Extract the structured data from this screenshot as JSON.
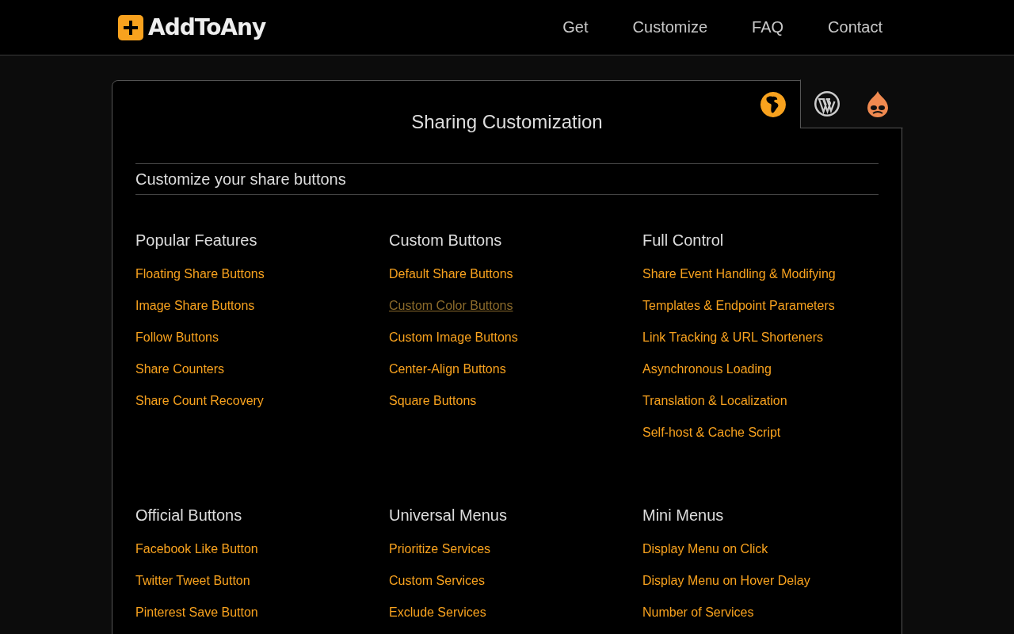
{
  "header": {
    "logo": "AddToAny",
    "nav": [
      {
        "label": "Get"
      },
      {
        "label": "Customize"
      },
      {
        "label": "FAQ"
      },
      {
        "label": "Contact"
      }
    ]
  },
  "platform_tabs": [
    {
      "kind": "globe",
      "selected": true
    },
    {
      "kind": "wordpress",
      "selected": false
    },
    {
      "kind": "drupal",
      "selected": false
    }
  ],
  "title": "Sharing Customization",
  "subtitle": "Customize your share buttons",
  "sections": [
    {
      "heading": "Popular Features",
      "links": [
        {
          "label": "Floating Share Buttons",
          "visited": false
        },
        {
          "label": "Image Share Buttons",
          "visited": false
        },
        {
          "label": "Follow Buttons",
          "visited": false
        },
        {
          "label": "Share Counters",
          "visited": false
        },
        {
          "label": "Share Count Recovery",
          "visited": false
        }
      ]
    },
    {
      "heading": "Custom Buttons",
      "links": [
        {
          "label": "Default Share Buttons",
          "visited": false
        },
        {
          "label": "Custom Color Buttons",
          "visited": true
        },
        {
          "label": "Custom Image Buttons",
          "visited": false
        },
        {
          "label": "Center-Align Buttons",
          "visited": false
        },
        {
          "label": "Square Buttons",
          "visited": false
        }
      ]
    },
    {
      "heading": "Full Control",
      "links": [
        {
          "label": "Share Event Handling & Modifying",
          "visited": false
        },
        {
          "label": "Templates & Endpoint Parameters",
          "visited": false
        },
        {
          "label": "Link Tracking & URL Shorteners",
          "visited": false
        },
        {
          "label": "Asynchronous Loading",
          "visited": false
        },
        {
          "label": "Translation & Localization",
          "visited": false
        },
        {
          "label": "Self-host & Cache Script",
          "visited": false
        }
      ]
    },
    {
      "heading": "Official Buttons",
      "links": [
        {
          "label": "Facebook Like Button",
          "visited": false
        },
        {
          "label": "Twitter Tweet Button",
          "visited": false
        },
        {
          "label": "Pinterest Save Button",
          "visited": false
        }
      ]
    },
    {
      "heading": "Universal Menus",
      "links": [
        {
          "label": "Prioritize Services",
          "visited": false
        },
        {
          "label": "Custom Services",
          "visited": false
        },
        {
          "label": "Exclude Services",
          "visited": false
        }
      ]
    },
    {
      "heading": "Mini Menus",
      "links": [
        {
          "label": "Display Menu on Click",
          "visited": false
        },
        {
          "label": "Display Menu on Hover Delay",
          "visited": false
        },
        {
          "label": "Number of Services",
          "visited": false
        }
      ]
    }
  ]
}
